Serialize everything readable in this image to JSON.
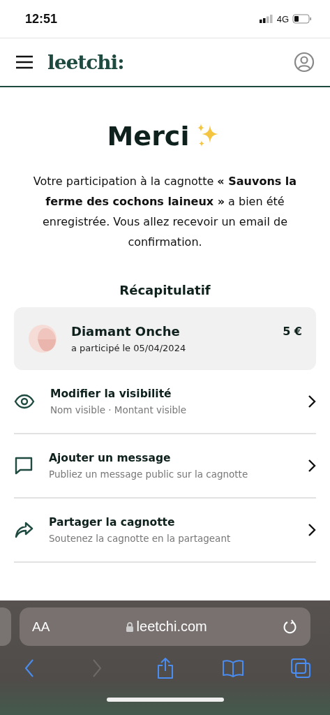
{
  "status_bar": {
    "time": "12:51",
    "network": "4G"
  },
  "header": {
    "logo": "leetchi:"
  },
  "title": "Merci",
  "message": "Votre participation à la cagnotte **« Sauvons la ferme des cochons laineux »** a bien été enregistrée. Vous allez recevoir un email de confirmation.",
  "summary": {
    "heading": "Récapitulatif",
    "name": "Diamant Onche",
    "date": "a participé le 05/04/2024",
    "amount": "5 €"
  },
  "actions": [
    {
      "kind": "visibility",
      "title": "Modifier la visibilité",
      "subtitle": "Nom visible · Montant visible"
    },
    {
      "kind": "message",
      "title": "Ajouter un message",
      "subtitle": "Publiez un message public sur la cagnotte"
    },
    {
      "kind": "share",
      "title": "Partager la cagnotte",
      "subtitle": "Soutenez la cagnotte en la partageant"
    }
  ],
  "browser": {
    "text_size": "AA",
    "url": "leetchi.com",
    "nav": [
      {
        "kind": "back",
        "disabled": false
      },
      {
        "kind": "forward",
        "disabled": true
      },
      {
        "kind": "share",
        "disabled": false
      },
      {
        "kind": "bookmarks",
        "disabled": false
      },
      {
        "kind": "tabs",
        "disabled": false
      }
    ]
  }
}
